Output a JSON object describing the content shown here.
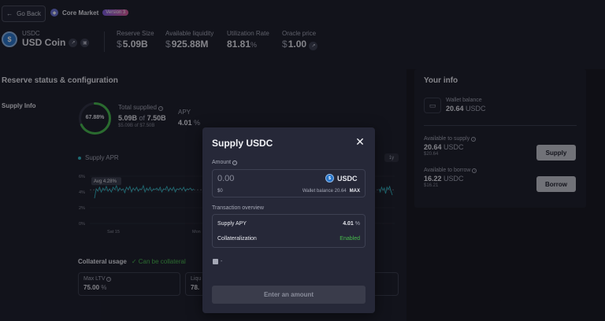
{
  "header": {
    "back_label": "Go Back",
    "market_name": "Core Market",
    "version_badge": "Version 3",
    "asset_symbol": "USDC",
    "asset_name": "USD Coin",
    "stats": [
      {
        "label": "Reserve Size",
        "currency": "$",
        "value": "5.09B"
      },
      {
        "label": "Available liquidity",
        "currency": "$",
        "value": "925.88M"
      },
      {
        "label": "Utilization Rate",
        "value": "81.81",
        "unit": "%"
      },
      {
        "label": "Oracle price",
        "currency": "$",
        "value": "1.00"
      }
    ]
  },
  "reserve": {
    "title": "Reserve status & configuration",
    "supply_info_label": "Supply Info",
    "ring_pct": "67.88%",
    "ring_fraction": 0.6788,
    "total_supplied_label": "Total supplied",
    "total_supplied_value": "5.09B",
    "total_supplied_of": "of",
    "total_supplied_cap": "7.50B",
    "total_supplied_usd": "$5.09B of $7.50B",
    "apy_label": "APY",
    "apy_value": "4.01",
    "apy_unit": "%",
    "legend_label": "Supply APR",
    "range_label": "1y",
    "avg_label": "Avg 4.28%",
    "collateral_title": "Collateral usage",
    "collateral_status": "✓ Can be collateral",
    "max_ltv_label": "Max LTV",
    "max_ltv_value": "75.00",
    "max_ltv_unit": "%",
    "liq_label": "Liqu",
    "liq_value": "78."
  },
  "chart_data": {
    "type": "line",
    "series": [
      {
        "name": "Supply APR",
        "values": [
          3.2,
          4.4,
          4.1,
          4.6,
          4.0,
          4.5,
          4.2,
          4.7,
          4.1,
          4.4,
          4.0,
          4.6,
          4.3,
          4.8,
          4.1,
          4.5,
          4.2,
          4.4,
          3.9,
          4.6,
          4.3,
          4.7,
          4.0,
          4.5,
          4.2,
          4.6,
          4.1,
          4.4,
          4.3,
          4.8,
          4.0,
          4.5,
          4.2,
          4.6,
          4.1,
          4.4,
          4.3,
          4.5,
          4.2,
          4.6,
          4.0,
          4.4,
          4.3,
          4.7,
          4.1,
          4.5,
          4.2,
          4.6,
          4.0,
          4.4,
          4.3,
          4.5,
          4.2,
          4.6,
          4.1,
          4.4,
          4.3,
          4.5,
          4.2,
          4.4
        ]
      }
    ],
    "yticks": [
      "6%",
      "4%",
      "2%",
      "0%"
    ],
    "ylim": [
      0,
      6
    ],
    "xticks": [
      "Sat 15",
      "Mon"
    ],
    "average": 4.28
  },
  "info": {
    "title": "Your info",
    "wallet_label": "Wallet balance",
    "wallet_value": "20.64",
    "wallet_unit": "USDC",
    "supply_label": "Available to supply",
    "supply_value": "20.64",
    "supply_unit": "USDC",
    "supply_usd": "$20.64",
    "supply_btn": "Supply",
    "borrow_label": "Available to borrow",
    "borrow_value": "16.22",
    "borrow_unit": "USDC",
    "borrow_usd": "$16.21",
    "borrow_btn": "Borrow"
  },
  "modal": {
    "title": "Supply USDC",
    "close_glyph": "✕",
    "amount_label": "Amount",
    "amount_placeholder": "0.00",
    "asset": "USDC",
    "usd_value": "$0",
    "wallet_balance": "Wallet balance 20.64",
    "max_label": "MAX",
    "overview_label": "Transaction overview",
    "supply_apy_label": "Supply APY",
    "supply_apy_value": "4.01",
    "supply_apy_unit": "%",
    "collateral_label": "Collateralization",
    "collateral_value": "Enabled",
    "gas_value": "-",
    "cta_label": "Enter an amount"
  }
}
